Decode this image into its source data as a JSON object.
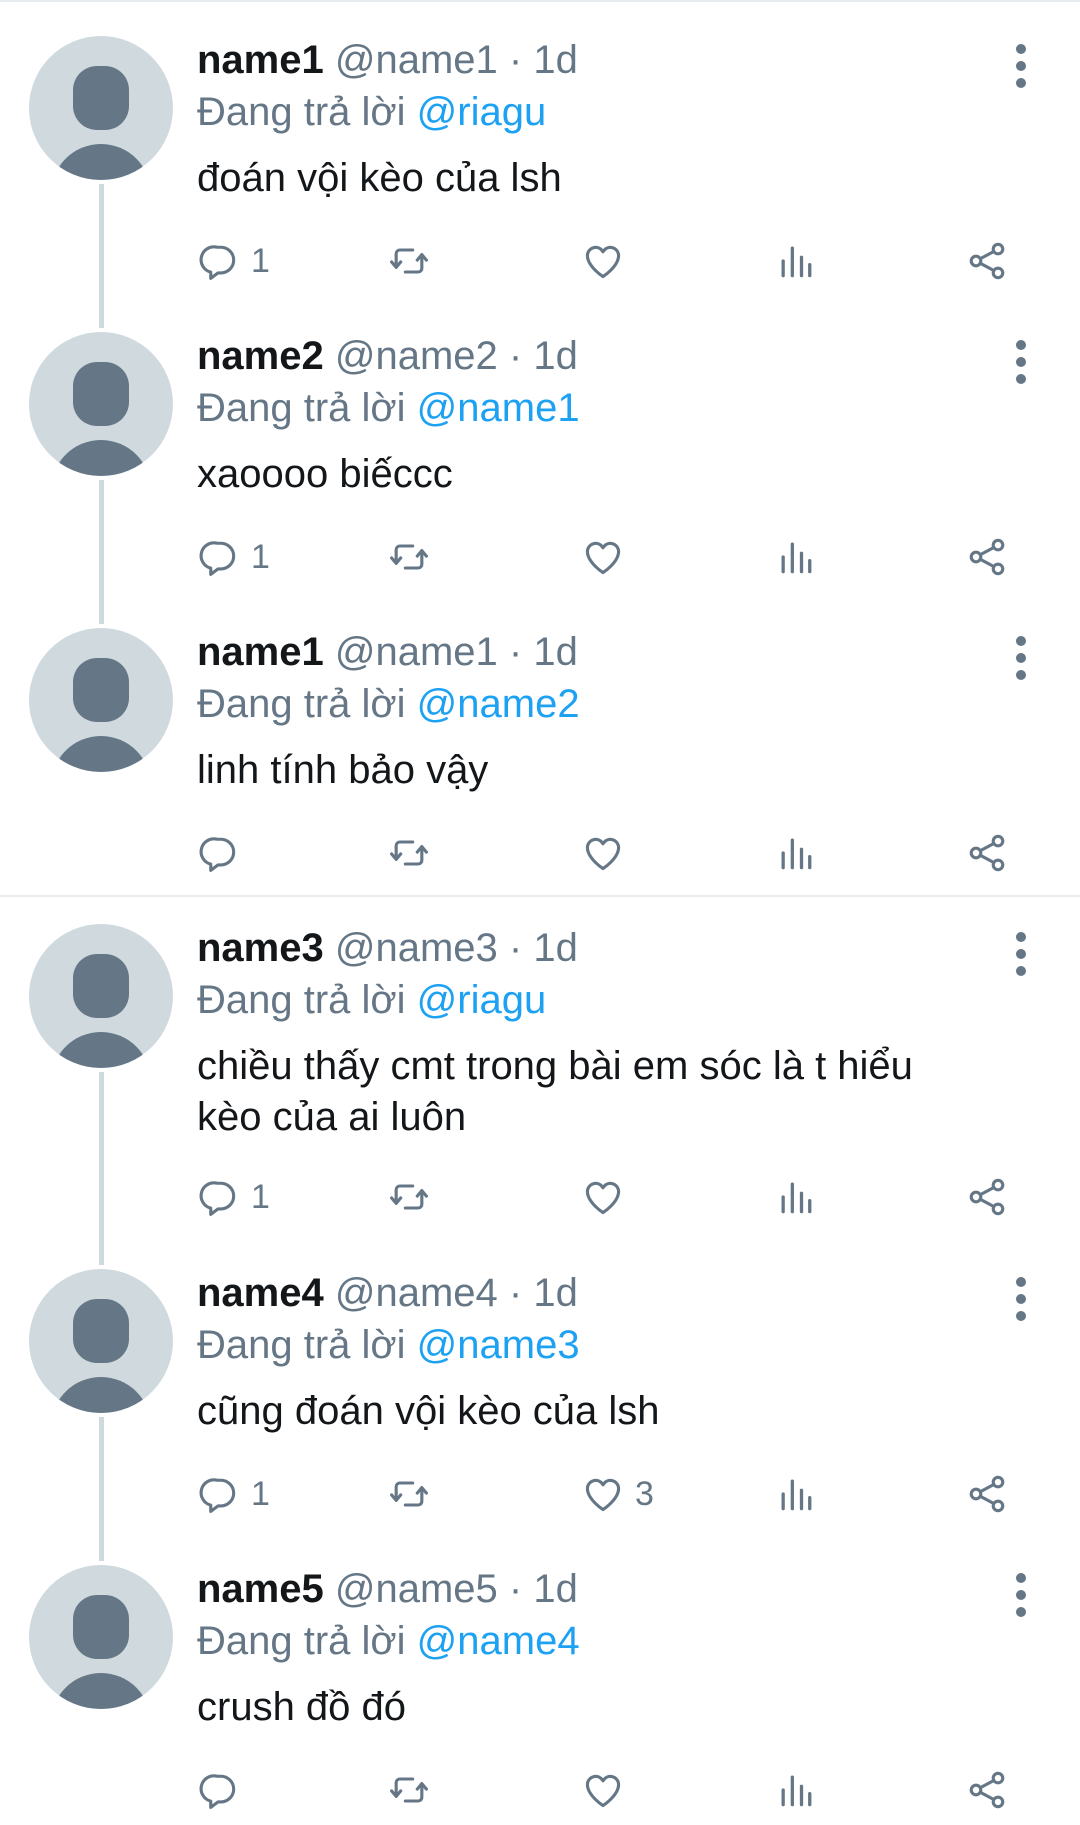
{
  "colors": {
    "text_primary": "#14171a",
    "text_secondary": "#657786",
    "mention": "#1da1f2",
    "divider": "#e6ecf0",
    "avatar_bg": "#cfd9de",
    "avatar_fg": "#657786"
  },
  "icons": {
    "reply": "reply-icon",
    "retweet": "retweet-icon",
    "like": "heart-icon",
    "views": "analytics-icon",
    "share": "share-icon",
    "more": "more-vertical-icon"
  },
  "threads": [
    {
      "tweets": [
        {
          "name": "name1",
          "handle": "@name1",
          "dot": "·",
          "time": "1d",
          "reply_prefix": "Đang trả lời",
          "reply_to": "@riagu",
          "text": "đoán vội kèo của lsh",
          "reply_count": "1",
          "like_count": ""
        },
        {
          "name": "name2",
          "handle": "@name2",
          "dot": "·",
          "time": "1d",
          "reply_prefix": "Đang trả lời",
          "reply_to": "@name1",
          "text": "xaoooo biếccc",
          "reply_count": "1",
          "like_count": ""
        },
        {
          "name": "name1",
          "handle": "@name1",
          "dot": "·",
          "time": "1d",
          "reply_prefix": "Đang trả lời",
          "reply_to": "@name2",
          "text": "linh tính bảo vậy",
          "reply_count": "",
          "like_count": ""
        }
      ]
    },
    {
      "tweets": [
        {
          "name": "name3",
          "handle": "@name3",
          "dot": "·",
          "time": "1d",
          "reply_prefix": "Đang trả lời",
          "reply_to": "@riagu",
          "text": "chiều thấy cmt trong bài em sóc là t hiểu kèo của ai luôn",
          "reply_count": "1",
          "like_count": ""
        },
        {
          "name": "name4",
          "handle": "@name4",
          "dot": "·",
          "time": "1d",
          "reply_prefix": "Đang trả lời",
          "reply_to": "@name3",
          "text": "cũng đoán vội kèo của lsh",
          "reply_count": "1",
          "like_count": "3"
        },
        {
          "name": "name5",
          "handle": "@name5",
          "dot": "·",
          "time": "1d",
          "reply_prefix": "Đang trả lời",
          "reply_to": "@name4",
          "text": "crush đồ đó",
          "reply_count": "",
          "like_count": ""
        }
      ]
    }
  ]
}
